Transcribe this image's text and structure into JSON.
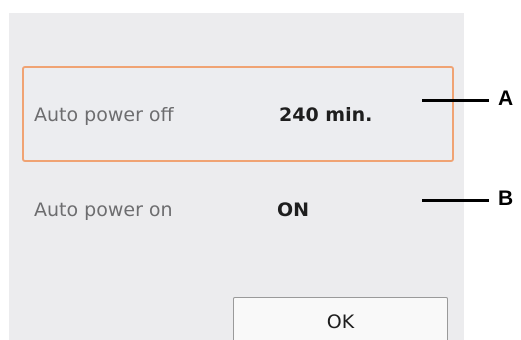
{
  "settings": [
    {
      "label": "Auto power off",
      "value": "240 min."
    },
    {
      "label": "Auto power on",
      "value": "ON"
    }
  ],
  "buttons": {
    "ok_label": "OK"
  },
  "callouts": {
    "a": "A",
    "b": "B"
  },
  "colors": {
    "panel_background": "#ececee",
    "selected_border": "#f0a373",
    "label_text": "#6d6d6f",
    "value_text": "#1e1e1e"
  }
}
